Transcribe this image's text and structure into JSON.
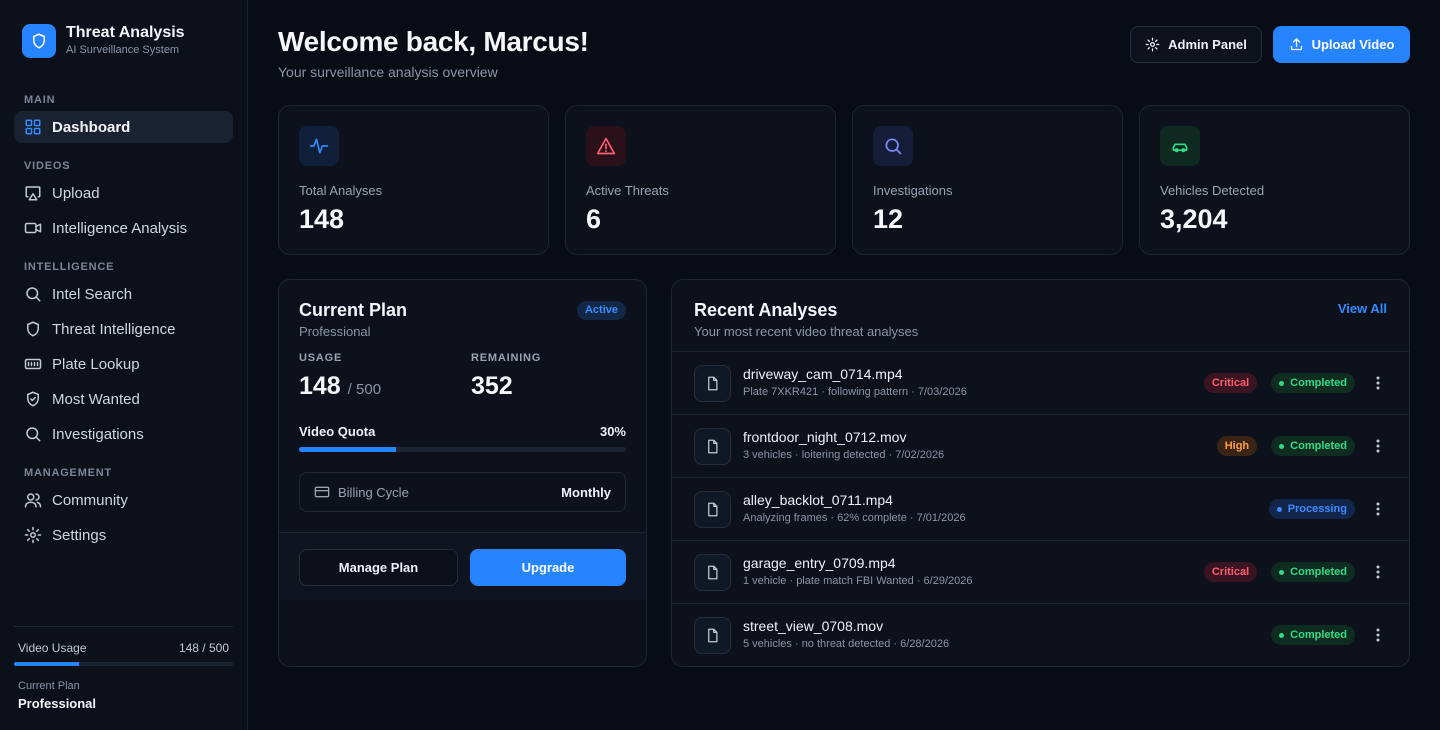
{
  "brand": {
    "title": "Threat Analysis",
    "subtitle": "AI Surveillance System"
  },
  "sidebar": {
    "sections": {
      "main": "MAIN",
      "videos": "VIDEOS",
      "intelligence": "INTELLIGENCE",
      "management": "MANAGEMENT"
    },
    "items": {
      "dashboard": "Dashboard",
      "upload": "Upload",
      "intelligence_analysis": "Intelligence Analysis",
      "intel_search": "Intel Search",
      "threat_intelligence": "Threat Intelligence",
      "plate_lookup": "Plate Lookup",
      "most_wanted": "Most Wanted",
      "investigations": "Investigations",
      "community": "Community",
      "settings": "Settings"
    },
    "usage": {
      "label": "Video Usage",
      "value": "148 / 500",
      "fraction": 0.296
    },
    "plan": {
      "label": "Current Plan",
      "value": "Professional"
    }
  },
  "header": {
    "title": "Welcome back, Marcus!",
    "subtitle": "Your surveillance analysis overview",
    "admin_label": "Admin Panel",
    "upload_label": "Upload Video"
  },
  "stats": {
    "total_analyses": {
      "label": "Total Analyses",
      "value": "148",
      "icon": "activity-icon",
      "color": "#2f8bff"
    },
    "active_threats": {
      "label": "Active Threats",
      "value": "6",
      "icon": "alert-triangle-icon",
      "color": "#ff5c70"
    },
    "investigations": {
      "label": "Investigations",
      "value": "12",
      "icon": "search-icon",
      "color": "#7b8cff"
    },
    "vehicles": {
      "label": "Vehicles Detected",
      "value": "3,204",
      "icon": "car-icon",
      "color": "#2edc86"
    }
  },
  "plan_card": {
    "title": "Current Plan",
    "name": "Professional",
    "status": "Active",
    "usage_label": "USAGE",
    "usage_value": "148",
    "usage_total": "/ 500",
    "remaining_label": "REMAINING",
    "remaining_value": "352",
    "quota_label": "Video Quota",
    "quota_percent": "30%",
    "quota_fraction": 0.296,
    "billing_label": "Billing Cycle",
    "billing_value": "Monthly",
    "manage_label": "Manage Plan",
    "upgrade_label": "Upgrade"
  },
  "recent": {
    "title": "Recent Analyses",
    "subtitle": "Your most recent video threat analyses",
    "view_all": "View All",
    "rows": [
      {
        "name": "driveway_cam_0714.mp4",
        "meta": "Plate 7XKR421 · following pattern · 7/03/2026",
        "severity": "Critical",
        "status": "Completed"
      },
      {
        "name": "frontdoor_night_0712.mov",
        "meta": "3 vehicles · loitering detected · 7/02/2026",
        "severity": "High",
        "status": "Completed"
      },
      {
        "name": "alley_backlot_0711.mp4",
        "meta": "Analyzing frames · 62% complete · 7/01/2026",
        "severity": "",
        "status": "Processing"
      },
      {
        "name": "garage_entry_0709.mp4",
        "meta": "1 vehicle · plate match FBI Wanted · 6/29/2026",
        "severity": "Critical",
        "status": "Completed"
      },
      {
        "name": "street_view_0708.mov",
        "meta": "5 vehicles · no threat detected · 6/28/2026",
        "severity": "",
        "status": "Completed"
      }
    ]
  },
  "colors": {
    "accent": "#2684ff",
    "background": "#080c14",
    "critical": "#ff5c70",
    "high": "#ff9f43",
    "success": "#2edc86"
  }
}
